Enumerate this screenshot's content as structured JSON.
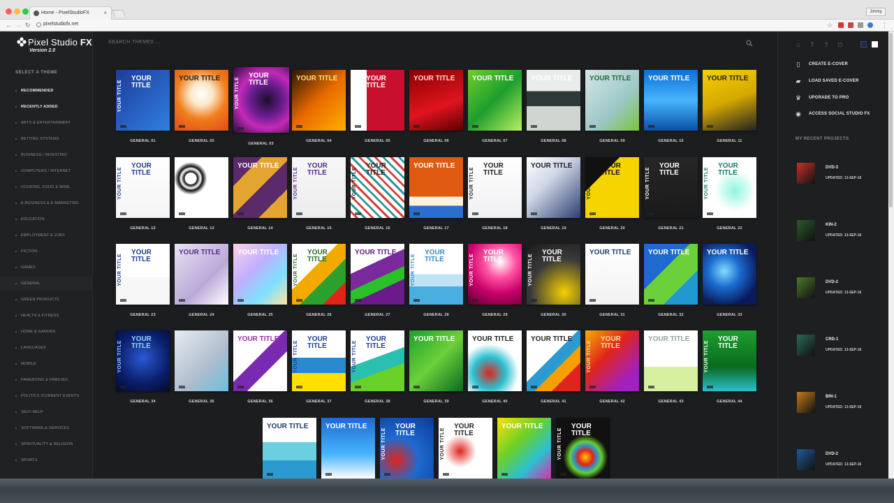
{
  "browser": {
    "tab_title": "Home - PixelStudioFX",
    "url": "pixelstudiofx.net",
    "user": "Jimmy"
  },
  "app": {
    "logo_light": "Pixel Studio",
    "logo_bold": "FX",
    "version": "Version 2.0",
    "search_placeholder": "SEARCH THEMES ...",
    "select_theme_heading": "SELECT A THEME",
    "categories": [
      "RECOMMENDED",
      "RECENTLY ADDED",
      "ARTS & ENTERTAINMENT",
      "BETTING SYSTEMS",
      "BUSINESS / INVESTING",
      "COMPUTERS / INTERNET",
      "COOKING, FOOD & WINE",
      "E-BUSINESS & E-MARKETING",
      "EDUCATION",
      "EMPLOYMENT & JOBS",
      "FICTION",
      "GAMES",
      "GENERAL",
      "GREEN PRODUCTS",
      "HEALTH & FITNESS",
      "HOME & GARDEN",
      "LANGUAGES",
      "MOBILE",
      "PARENTING & FAMILIES",
      "POLITICS /CURRENT EVENTS",
      "SELF-HELP",
      "SOFTWARE & SERVICES",
      "SPIRITUALITY & RELIGION",
      "SPORTS"
    ],
    "selected_category": "GENERAL",
    "actions": [
      "CREATE E-COVER",
      "LOAD SAVED E-COVER",
      "UPGRADE TO PRO",
      "ACCESS SOCIAL STUDIO FX"
    ],
    "recent_heading": "MY RECENT PROJECTS",
    "recent_projects": [
      {
        "name": "DVD-3",
        "updated": "UPDATED: 13-SEP-16"
      },
      {
        "name": "KIN-2",
        "updated": "UPDATED: 13-SEP-16"
      },
      {
        "name": "DVD-2",
        "updated": "UPDATED: 13-SEP-16"
      },
      {
        "name": "CRD-1",
        "updated": "UPDATED: 13-SEP-16"
      },
      {
        "name": "BIN-1",
        "updated": "UPDATED: 13-SEP-16"
      },
      {
        "name": "DVD-2",
        "updated": "UPDATED: 13-SEP-16"
      }
    ],
    "themes": [
      {
        "label": "GENERAL 01",
        "bg": "linear-gradient(135deg,#1e3c9c,#2f7fe0)",
        "text": "YOUR TITLE",
        "tc": "#ffffff",
        "vert": "YOUR TITLE"
      },
      {
        "label": "GENERAL 02",
        "bg": "radial-gradient(circle at 50% 40%,#ffffff 0%,#fbe7c9 25%,#f07d1b 55%,#e04a1c 100%)",
        "text": "YOUR TITLE",
        "tc": "#222222"
      },
      {
        "label": "GENERAL 03",
        "bg": "radial-gradient(circle at 60% 50%,#1c0f2b 0%,#6a1d8f 35%,#c32ab8 60%,#2a0a3a 100%)",
        "text": "YOUR TITLE",
        "tc": "#ffffff",
        "vert": "YOUR TITLE"
      },
      {
        "label": "GENERAL 04",
        "bg": "linear-gradient(135deg,#2a1600,#e86a00 50%,#ffb000)",
        "text": "YOUR TITLE",
        "tc": "#ffe07a"
      },
      {
        "label": "GENERAL 05",
        "bg": "linear-gradient(90deg,#ffffff 0 30%,#c8102e 30% 100%)",
        "text": "YOUR TITLE",
        "tc": "#ffffff",
        "vert": "YOUR TITLE"
      },
      {
        "label": "GENERAL 06",
        "bg": "linear-gradient(160deg,#8b0000,#e0141e 60%,#5a0000)",
        "text": "YOUR TITLE",
        "tc": "#ffd8d8"
      },
      {
        "label": "GENERAL 07",
        "bg": "linear-gradient(135deg,#6bd02a,#1e9e2e 50%,#b8f060)",
        "text": "YOUR TITLE",
        "tc": "#ffffff"
      },
      {
        "label": "GENERAL 08",
        "bg": "linear-gradient(180deg,#e9ecea 0 35%,#2e3a3a 35% 60%,#cfd6d2 60%)",
        "text": "YOUR TITLE",
        "tc": "#ffffff"
      },
      {
        "label": "GENERAL 09",
        "bg": "linear-gradient(135deg,#d7e6e8,#9cc7c6 60%,#7ac43c)",
        "text": "YOUR TITLE",
        "tc": "#1f6b3a"
      },
      {
        "label": "GENERAL 10",
        "bg": "linear-gradient(180deg,#0b6fd6,#48b5ff 50%,#0b4fa6)",
        "text": "YOUR TITLE",
        "tc": "#ffffff"
      },
      {
        "label": "GENERAL 11",
        "bg": "linear-gradient(160deg,#f5d000,#d6a800 50%,#222 100%)",
        "text": "YOUR TITLE",
        "tc": "#222222"
      },
      {
        "label": "GENERAL 12",
        "bg": "linear-gradient(180deg,#ffffff,#f4f4f4)",
        "text": "YOUR TITLE",
        "tc": "#1e3c8c",
        "vert": "YOUR TITLE"
      },
      {
        "label": "GENERAL 13",
        "bg": "radial-gradient(circle at 30% 35%,#fff 10%,#111 12%,#fff 18%,#111 22%,#fff 30%),radial-gradient(circle at 70% 70%,#fff 8%,#111 10%,#fff 16%,#111 20%,#eee 28%)",
        "text": "",
        "tc": "#222222"
      },
      {
        "label": "GENERAL 14",
        "bg": "linear-gradient(135deg,#5a2a6a 25%,#e3a530 25% 50%,#5a2a6a 50% 75%,#e3a530 75%)",
        "text": "YOUR TITLE",
        "tc": "#ffffff"
      },
      {
        "label": "GENERAL 15",
        "bg": "linear-gradient(180deg,#f7f7f7,#ececec)",
        "text": "YOUR TITLE",
        "tc": "#5a2a8a",
        "vert": "YOUR TITLE"
      },
      {
        "label": "GENERAL 16",
        "bg": "repeating-linear-gradient(45deg,#ffffff 0 5px,#e23a3a 5px 8px,#ffffff 8px 13px,#2a9a9a 13px 16px)",
        "text": "YOUR TITLE",
        "tc": "#222222",
        "vert": "YOUR TITLE"
      },
      {
        "label": "GENERAL 17",
        "bg": "linear-gradient(180deg,#e15a12 0 65%,#fff2dc 65% 80%,#2a6ed0 80%)",
        "text": "YOUR TITLE",
        "tc": "#ffffff"
      },
      {
        "label": "GENERAL 18",
        "bg": "linear-gradient(180deg,#ffffff,#f0f0f4)",
        "text": "YOUR TITLE",
        "tc": "#222222",
        "vert": "YOUR TITLE"
      },
      {
        "label": "GENERAL 19",
        "bg": "linear-gradient(135deg,#ffffff,#cfd6e6 40%,#2a3e72)",
        "text": "YOUR TITLE",
        "tc": "#222222"
      },
      {
        "label": "GENERAL 20",
        "bg": "linear-gradient(135deg,#111 0 30%,#f5d400 30% 100%)",
        "text": "YOUR TITLE",
        "tc": "#111111",
        "vert": "YOUR TITLE"
      },
      {
        "label": "GENERAL 21",
        "bg": "linear-gradient(180deg,#262626,#1a1a1a)",
        "text": "YOUR TITLE",
        "tc": "#ffffff",
        "vert": "YOUR TITLE"
      },
      {
        "label": "GENERAL 22",
        "bg": "radial-gradient(ellipse at 60% 55%,#8ff5e0 0%,#ffffff 45%,#ffffff 100%)",
        "text": "YOUR TITLE",
        "tc": "#1a7a6a",
        "vert": "YOUR TITLE"
      },
      {
        "label": "GENERAL 23",
        "bg": "linear-gradient(180deg,#ffffff 0 55%,#f7f7f7 55%)",
        "text": "YOUR TITLE",
        "tc": "#1e3c8c",
        "vert": "YOUR TITLE"
      },
      {
        "label": "GENERAL 24",
        "bg": "linear-gradient(135deg,#eae4f2,#b9a9d8 60%,#ffffff)",
        "text": "YOUR TITLE",
        "tc": "#5a2a8a"
      },
      {
        "label": "GENERAL 25",
        "bg": "linear-gradient(135deg,#ffd0e8,#c0b0ff 40%,#7ee0ff 70%,#ffe6a0)",
        "text": "YOUR TITLE",
        "tc": "#ffffff"
      },
      {
        "label": "GENERAL 26",
        "bg": "linear-gradient(135deg,#ffffff 0 40%,#f2a900 40% 60%,#2ca02c 60% 80%,#e0241c 80%)",
        "text": "YOUR TITLE",
        "tc": "#2a6a2a",
        "vert": "YOUR TITLE"
      },
      {
        "label": "GENERAL 27",
        "bg": "linear-gradient(155deg,#ffffff 0 35%,#7a2a9a 35% 55%,#2ac02a 55% 70%,#6a1a8a 70%)",
        "text": "YOUR TITLE",
        "tc": "#5a1a7a"
      },
      {
        "label": "GENERAL 28",
        "bg": "linear-gradient(180deg,#ffffff 0 50%,#bfe3f5 50% 70%,#4aaee0 70%)",
        "text": "YOUR TITLE",
        "tc": "#3a8ac0",
        "vert": "YOUR TITLE"
      },
      {
        "label": "GENERAL 29",
        "bg": "radial-gradient(circle at 60% 30%,#ffffff 0%,#ff4fa0 30%,#c8006a 60%,#5a0030 100%)",
        "text": "YOUR TITLE",
        "tc": "#ffffff",
        "vert": "YOUR TITLE"
      },
      {
        "label": "GENERAL 30",
        "bg": "radial-gradient(circle at 70% 80%,#f5d000 0%,#3a3a3a 55%,#1a1a1a 100%)",
        "text": "YOUR TITLE",
        "tc": "#ffffff",
        "vert": "YOUR TITLE"
      },
      {
        "label": "GENERAL 31",
        "bg": "linear-gradient(180deg,#ffffff,#f2f2f2)",
        "text": "YOUR TITLE",
        "tc": "#1e3c6c"
      },
      {
        "label": "GENERAL 32",
        "bg": "linear-gradient(135deg,#1e6ad0 0 40%,#6cd03a 40% 70%,#1e9ad0 70%)",
        "text": "YOUR TITLE",
        "tc": "#ffffff"
      },
      {
        "label": "GENERAL 33",
        "bg": "radial-gradient(circle at 40% 45%,#7fdcff 0%,#1a6ad0 35%,#0a1a5a 75%)",
        "text": "YOUR TITLE",
        "tc": "#ffffff"
      },
      {
        "label": "GENERAL 34",
        "bg": "radial-gradient(circle at 50% 45%,#2a5ad0 0%,#0a1e6a 60%,#050a2a 100%)",
        "text": "YOUR TITLE",
        "tc": "#9ad0ff",
        "vert": "YOUR TITLE"
      },
      {
        "label": "GENERAL 35",
        "bg": "linear-gradient(135deg,#e6ecf2,#aebccc 60%,#6ac0e0)",
        "text": "",
        "tc": "#1e3c6c"
      },
      {
        "label": "GENERAL 36",
        "bg": "linear-gradient(135deg,#ffffff 0 45%,#7a2ab0 45% 65%,#ffffff 65%)",
        "text": "YOUR TITLE",
        "tc": "#a02ab0"
      },
      {
        "label": "GENERAL 37",
        "bg": "linear-gradient(180deg,#ffffff 0 45%,#2a8ad0 45% 70%,#ffe000 70%)",
        "text": "YOUR TITLE",
        "tc": "#1e3c9c",
        "vert": "YOUR TITLE"
      },
      {
        "label": "GENERAL 38",
        "bg": "linear-gradient(160deg,#ffffff 0 45%,#2ac0b0 45% 65%,#6ad02a 65%)",
        "text": "YOUR TITLE",
        "tc": "#1e3c9c",
        "vert": "YOUR TITLE"
      },
      {
        "label": "GENERAL 39",
        "bg": "linear-gradient(135deg,#1e9e2e,#6cd03a 50%,#0a6a1e)",
        "text": "YOUR TITLE",
        "tc": "#ffffff"
      },
      {
        "label": "GENERAL 40",
        "bg": "radial-gradient(circle at 40% 70%,#e0241c 0%,#2ac0d0 30%,#ffffff 55%)",
        "text": "YOUR TITLE",
        "tc": "#222222"
      },
      {
        "label": "GENERAL 41",
        "bg": "linear-gradient(135deg,#ffffff 0 45%,#2a9ad0 45% 60%,#f5a000 60% 75%,#e0241c 75%)",
        "text": "YOUR TITLE",
        "tc": "#222222"
      },
      {
        "label": "GENERAL 42",
        "bg": "linear-gradient(135deg,#f5b000,#e0241c 40%,#a020c0 80%)",
        "text": "YOUR TITLE",
        "tc": "#ffe0a0",
        "vert": "YOUR TITLE"
      },
      {
        "label": "GENERAL 43",
        "bg": "linear-gradient(180deg,#ffffff 0 60%,#d6f0a0 60%)",
        "text": "YOUR TITLE",
        "tc": "#9aa0a0"
      },
      {
        "label": "GENERAL 44",
        "bg": "linear-gradient(180deg,#1e9e2e,#0a6a1e 60%,#2ac0d0)",
        "text": "YOUR TITLE",
        "tc": "#ffffff",
        "vert": "YOUR TITLE"
      },
      {
        "label": "",
        "bg": "linear-gradient(180deg,#ffffff 0 40%,#6ad0e0 40% 70%,#2a9ad0 70%)",
        "text": "YOUR TITLE",
        "tc": "#1e3c6c"
      },
      {
        "label": "",
        "bg": "linear-gradient(180deg,#1e6ad0,#48b5ff 60%,#ffffff)",
        "text": "YOUR TITLE",
        "tc": "#ffffff"
      },
      {
        "label": "",
        "bg": "radial-gradient(circle at 30% 70%,#e0241c 0%,#1e6ad0 40%,#0a3a9a 100%)",
        "text": "YOUR TITLE",
        "tc": "#ffffff",
        "vert": "YOUR TITLE"
      },
      {
        "label": "",
        "bg": "radial-gradient(circle at 40% 55%,#e0241c 0%,#ffffff 35%,#ffffff 100%)",
        "text": "YOUR TITLE",
        "tc": "#222222",
        "vert": "YOUR TITLE"
      },
      {
        "label": "",
        "bg": "linear-gradient(135deg,#ffe000,#6ad02a 40%,#2ac0d0 70%,#e02ab0)",
        "text": "YOUR TITLE",
        "tc": "#ffffff"
      },
      {
        "label": "",
        "bg": "radial-gradient(circle at 55% 65%,#f5d000 0%,#e0241c 15%,#2a9ad0 25%,#6ad02a 32%,#111 45%)",
        "text": "YOUR TITLE",
        "tc": "#ffffff",
        "vert": "YOUR TITLE"
      }
    ]
  }
}
